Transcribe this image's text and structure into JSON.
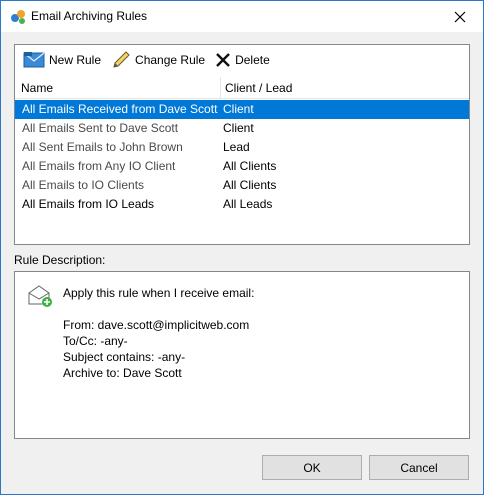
{
  "window": {
    "title": "Email Archiving Rules"
  },
  "toolbar": {
    "new_rule": "New Rule",
    "change_rule": "Change Rule",
    "delete": "Delete"
  },
  "list": {
    "headers": {
      "name": "Name",
      "client": "Client / Lead"
    },
    "rows": [
      {
        "name": "All Emails Received from Dave Scott",
        "client": "Client",
        "selected": true
      },
      {
        "name": "All Emails Sent to Dave Scott",
        "client": "Client"
      },
      {
        "name": "All Sent Emails to John Brown",
        "client": "Lead"
      },
      {
        "name": "All Emails from Any IO Client",
        "client": "All Clients"
      },
      {
        "name": "All Emails to IO Clients",
        "client": "All Clients"
      },
      {
        "name": "All Emails from IO Leads",
        "client": "All Leads"
      }
    ]
  },
  "description": {
    "label": "Rule Description:",
    "intro": "Apply this rule when I receive email:",
    "from": "From: dave.scott@implicitweb.com",
    "tocc": "To/Cc: -any-",
    "subject": "Subject contains: -any-",
    "archive": "Archive to:  Dave Scott"
  },
  "buttons": {
    "ok": "OK",
    "cancel": "Cancel"
  },
  "colors": {
    "selection": "#0078d7",
    "border": "#828790",
    "accent": "#2b78c8"
  }
}
